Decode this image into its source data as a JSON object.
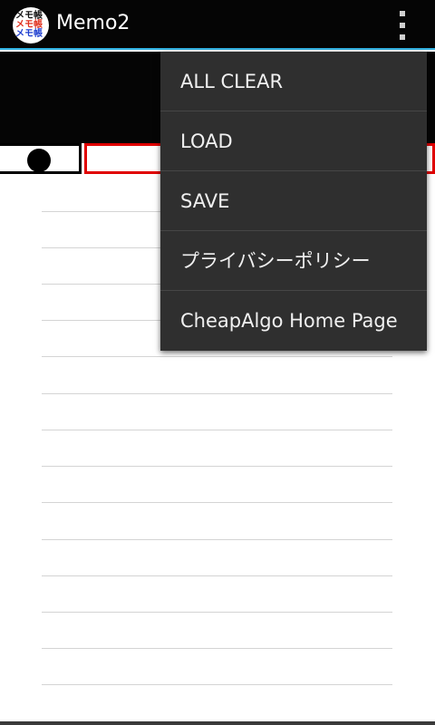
{
  "action_bar": {
    "app_icon": {
      "name": "memo-app-icon",
      "lines": [
        "メモ帳",
        "メモ帳",
        "メモ帳"
      ],
      "colors": [
        "#111111",
        "#e0301e",
        "#2040d0"
      ]
    },
    "title": "Memo2",
    "overflow_icon": "overflow-menu-icon",
    "accent_color": "#33b5e5"
  },
  "toolbar": {
    "pen_color": "#000000",
    "eraser_border_color": "#e00000"
  },
  "overflow_menu": {
    "items": [
      {
        "label": "ALL CLEAR"
      },
      {
        "label": "LOAD"
      },
      {
        "label": "SAVE"
      },
      {
        "label": "プライバシーポリシー"
      },
      {
        "label": "CheapAlgo Home Page"
      }
    ]
  }
}
